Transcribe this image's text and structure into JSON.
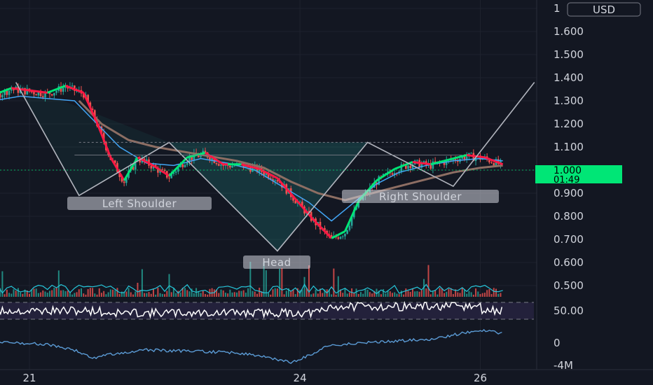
{
  "chart_data": {
    "type": "candlestick",
    "currency": "USD",
    "price_axis": {
      "ticks": [
        "1",
        "1.600",
        "1.500",
        "1.400",
        "1.300",
        "1.200",
        "1.100",
        "1.000",
        "0.900",
        "0.800",
        "0.700",
        "0.600",
        "0.500"
      ],
      "tick_values": [
        1.7,
        1.6,
        1.5,
        1.4,
        1.3,
        1.2,
        1.1,
        1.0,
        0.9,
        0.8,
        0.7,
        0.6,
        0.5
      ]
    },
    "last_price": {
      "value": "1.000",
      "countdown": "01:49",
      "color": "#00e676"
    },
    "rsi_panel": {
      "label": "50.00",
      "band": [
        30,
        70
      ]
    },
    "volume_indicator": {
      "labels": [
        "0",
        "-4M"
      ]
    },
    "x_axis": {
      "ticks": [
        "21",
        "24",
        "26"
      ],
      "tick_pos": [
        1,
        4,
        6
      ]
    },
    "pattern": {
      "name_labels": {
        "left": "Left Shoulder",
        "head": "Head",
        "right": "Right Shoulder"
      },
      "vertices": [
        {
          "t": 0.85,
          "p": 1.38
        },
        {
          "t": 1.55,
          "p": 0.89
        },
        {
          "t": 2.55,
          "p": 1.12
        },
        {
          "t": 3.75,
          "p": 0.65
        },
        {
          "t": 4.75,
          "p": 1.12
        },
        {
          "t": 5.7,
          "p": 0.93
        },
        {
          "t": 6.6,
          "p": 1.38
        }
      ],
      "neckline": 1.12,
      "levels": [
        1.065,
        1.0
      ]
    },
    "price_series": [
      [
        0.0,
        1.35
      ],
      [
        0.2,
        1.32
      ],
      [
        0.4,
        1.28
      ],
      [
        0.6,
        1.32
      ],
      [
        0.8,
        1.35
      ],
      [
        1.0,
        1.34
      ],
      [
        1.2,
        1.33
      ],
      [
        1.4,
        1.36
      ],
      [
        1.6,
        1.33
      ],
      [
        1.75,
        1.2
      ],
      [
        1.9,
        1.05
      ],
      [
        2.05,
        0.95
      ],
      [
        2.2,
        1.05
      ],
      [
        2.35,
        1.02
      ],
      [
        2.55,
        0.97
      ],
      [
        2.75,
        1.05
      ],
      [
        2.95,
        1.07
      ],
      [
        3.15,
        1.02
      ],
      [
        3.35,
        1.02
      ],
      [
        3.55,
        1.0
      ],
      [
        3.75,
        0.96
      ],
      [
        3.95,
        0.87
      ],
      [
        4.15,
        0.78
      ],
      [
        4.35,
        0.7
      ],
      [
        4.5,
        0.73
      ],
      [
        4.65,
        0.86
      ],
      [
        4.85,
        0.95
      ],
      [
        5.05,
        1.0
      ],
      [
        5.25,
        1.03
      ],
      [
        5.45,
        1.02
      ],
      [
        5.65,
        1.04
      ],
      [
        5.85,
        1.06
      ],
      [
        6.05,
        1.05
      ],
      [
        6.25,
        1.02
      ]
    ],
    "ma_blue": [
      [
        0.0,
        1.26
      ],
      [
        0.3,
        1.28
      ],
      [
        0.6,
        1.3
      ],
      [
        0.9,
        1.32
      ],
      [
        1.2,
        1.31
      ],
      [
        1.5,
        1.3
      ],
      [
        1.75,
        1.2
      ],
      [
        2.0,
        1.1
      ],
      [
        2.3,
        1.03
      ],
      [
        2.6,
        1.02
      ],
      [
        2.9,
        1.05
      ],
      [
        3.2,
        1.03
      ],
      [
        3.5,
        1.0
      ],
      [
        3.8,
        0.93
      ],
      [
        4.1,
        0.86
      ],
      [
        4.35,
        0.78
      ],
      [
        4.6,
        0.86
      ],
      [
        4.85,
        0.94
      ],
      [
        5.1,
        0.99
      ],
      [
        5.4,
        1.02
      ],
      [
        5.7,
        1.04
      ],
      [
        6.0,
        1.05
      ],
      [
        6.25,
        1.04
      ]
    ],
    "ma_brown": [
      [
        1.55,
        1.3
      ],
      [
        1.8,
        1.2
      ],
      [
        2.1,
        1.13
      ],
      [
        2.4,
        1.1
      ],
      [
        2.7,
        1.08
      ],
      [
        3.0,
        1.06
      ],
      [
        3.3,
        1.04
      ],
      [
        3.6,
        1.01
      ],
      [
        3.9,
        0.95
      ],
      [
        4.2,
        0.9
      ],
      [
        4.5,
        0.87
      ],
      [
        4.8,
        0.9
      ],
      [
        5.1,
        0.93
      ],
      [
        5.4,
        0.96
      ],
      [
        5.7,
        0.99
      ],
      [
        6.0,
        1.01
      ],
      [
        6.25,
        1.02
      ]
    ]
  }
}
